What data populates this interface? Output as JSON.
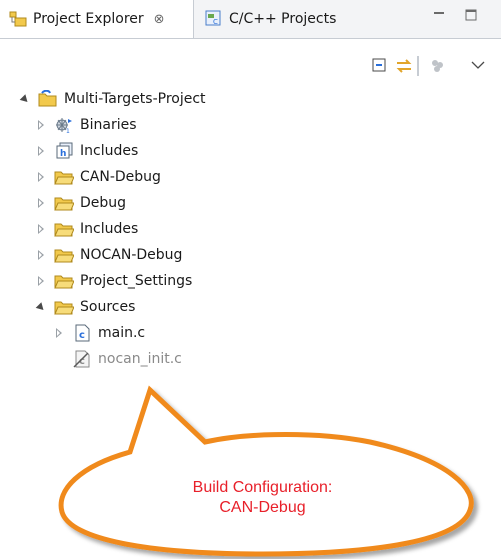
{
  "tabs": {
    "project_explorer": {
      "label": "Project Explorer",
      "close": "⊗"
    },
    "cpp_projects": {
      "label": "C/C++ Projects"
    }
  },
  "tree": {
    "root": {
      "label": "Multi-Targets-Project"
    },
    "items": [
      {
        "label": "Binaries",
        "icon": "binaries-icon"
      },
      {
        "label": "Includes",
        "icon": "includes-icon"
      },
      {
        "label": "CAN-Debug",
        "icon": "folder-icon"
      },
      {
        "label": "Debug",
        "icon": "folder-icon"
      },
      {
        "label": "Includes",
        "icon": "folder-icon"
      },
      {
        "label": "NOCAN-Debug",
        "icon": "folder-icon"
      },
      {
        "label": "Project_Settings",
        "icon": "folder-icon"
      },
      {
        "label": "Sources",
        "icon": "folder-icon"
      }
    ],
    "sources_children": [
      {
        "label": "main.c",
        "icon": "c-file-icon"
      },
      {
        "label": "nocan_init.c",
        "icon": "excluded-c-file-icon"
      }
    ]
  },
  "callout": {
    "line1": "Build Configuration:",
    "line2": "CAN-Debug"
  },
  "colors": {
    "folder": "#f2c94c",
    "callout_border": "#f08a1c",
    "callout_text": "#e8202a",
    "accent_blue": "#2a6fdb"
  }
}
